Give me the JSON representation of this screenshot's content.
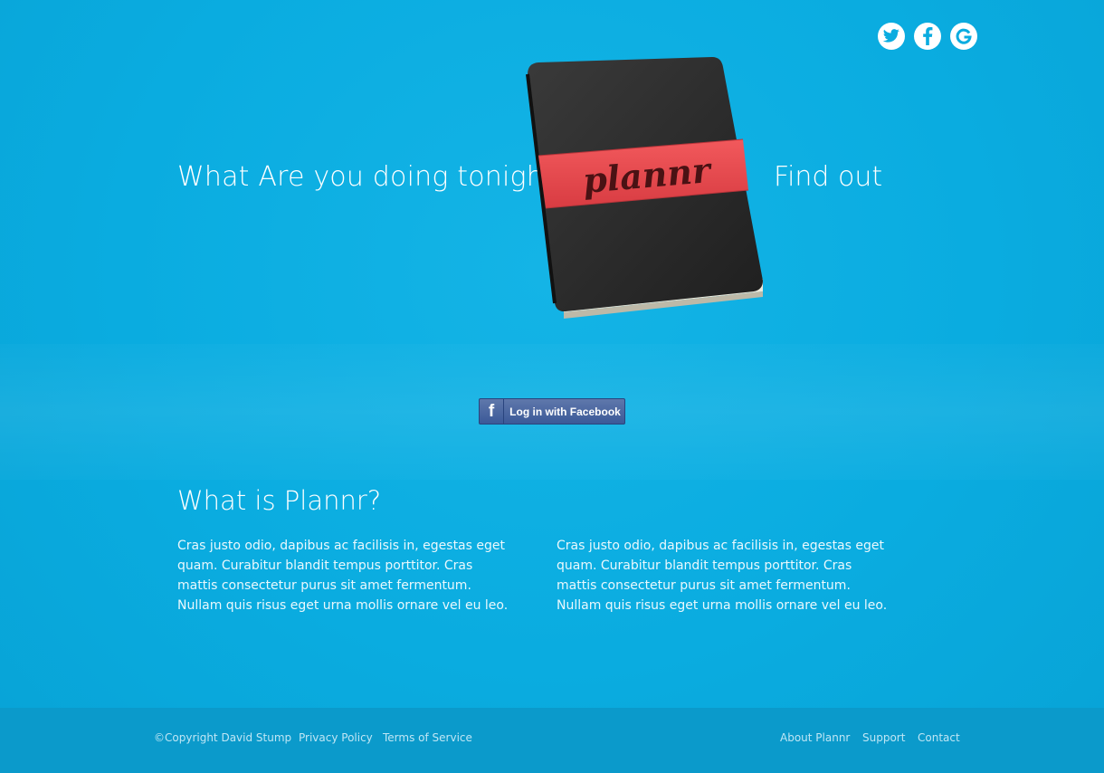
{
  "header": {
    "social": [
      {
        "icon": "twitter-icon"
      },
      {
        "icon": "facebook-icon"
      },
      {
        "icon": "google-icon"
      }
    ]
  },
  "hero": {
    "tagline_left": "What Are you doing tonight?",
    "tagline_right": "Find out",
    "book_label": "plannr"
  },
  "login": {
    "button_icon": "f",
    "button_label": "Log in with Facebook"
  },
  "about": {
    "title": "What is Plannr?",
    "col1": "Cras justo odio, dapibus ac facilisis in, egestas eget quam. Curabitur blandit tempus porttitor. Cras mattis consectetur purus sit amet fermentum. Nullam quis risus eget urna mollis ornare vel eu leo.",
    "col2": "Cras justo odio, dapibus ac facilisis in, egestas eget quam. Curabitur blandit tempus porttitor. Cras mattis consectetur purus sit amet fermentum. Nullam quis risus eget urna mollis ornare vel eu leo."
  },
  "footer": {
    "copyright": "©Copyright David Stump",
    "privacy": "Privacy Policy",
    "terms": "Terms of Service",
    "about": "About Plannr",
    "support": "Support",
    "contact": "Contact"
  },
  "colors": {
    "background": "#0aace0",
    "footer": "#0b9acb",
    "band_red": "#e84a4f",
    "facebook_blue": "#3b5998"
  }
}
